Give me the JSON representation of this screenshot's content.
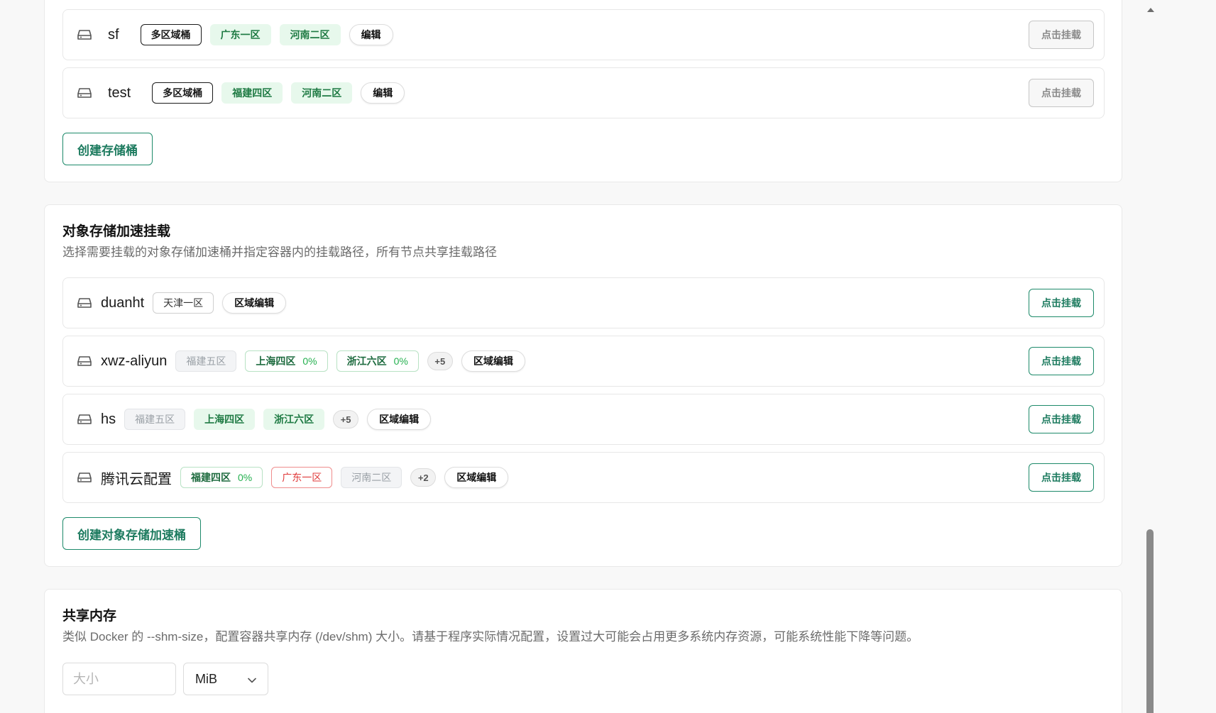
{
  "buckets_section": {
    "rows": [
      {
        "name": "sf",
        "tags": [
          {
            "label": "多区域桶",
            "style": "outline-dark"
          },
          {
            "label": "广东一区",
            "style": "green-fill"
          },
          {
            "label": "河南二区",
            "style": "green-fill"
          }
        ],
        "edit_label": "编辑",
        "mount_label": "点击挂载"
      },
      {
        "name": "test",
        "tags": [
          {
            "label": "多区域桶",
            "style": "outline-dark"
          },
          {
            "label": "福建四区",
            "style": "green-fill"
          },
          {
            "label": "河南二区",
            "style": "green-fill"
          }
        ],
        "edit_label": "编辑",
        "mount_label": "点击挂载"
      }
    ],
    "create_label": "创建存储桶"
  },
  "accel_section": {
    "title": "对象存储加速挂载",
    "description": "选择需要挂载的对象存储加速桶并指定容器内的挂载路径，所有节点共享挂载路径",
    "rows": [
      {
        "name": "duanht",
        "tags": [
          {
            "label": "天津一区",
            "pct": "",
            "style": "neutral-outline"
          }
        ],
        "count": "",
        "edit_label": "区域编辑",
        "mount_label": "点击挂载"
      },
      {
        "name": "xwz-aliyun",
        "tags": [
          {
            "label": "福建五区",
            "pct": "",
            "style": "gray"
          },
          {
            "label": "上海四区",
            "pct": "0%",
            "style": "green-outline"
          },
          {
            "label": "浙江六区",
            "pct": "0%",
            "style": "green-outline"
          }
        ],
        "count": "+5",
        "edit_label": "区域编辑",
        "mount_label": "点击挂载"
      },
      {
        "name": "hs",
        "tags": [
          {
            "label": "福建五区",
            "pct": "",
            "style": "gray"
          },
          {
            "label": "上海四区",
            "pct": "",
            "style": "green-fill"
          },
          {
            "label": "浙江六区",
            "pct": "",
            "style": "green-fill"
          }
        ],
        "count": "+5",
        "edit_label": "区域编辑",
        "mount_label": "点击挂载"
      },
      {
        "name": "腾讯云配置",
        "tags": [
          {
            "label": "福建四区",
            "pct": "0%",
            "style": "green-outline"
          },
          {
            "label": "广东一区",
            "pct": "",
            "style": "red-outline"
          },
          {
            "label": "河南二区",
            "pct": "",
            "style": "gray"
          }
        ],
        "count": "+2",
        "edit_label": "区域编辑",
        "mount_label": "点击挂载"
      }
    ],
    "create_label": "创建对象存储加速桶"
  },
  "shm_section": {
    "title": "共享内存",
    "description": "类似 Docker 的 --shm-size，配置容器共享内存 (/dev/shm) 大小。请基于程序实际情况配置，设置过大可能会占用更多系统内存资源，可能系统性能下降等问题。",
    "size_placeholder": "大小",
    "size_value": "",
    "unit": "MiB"
  },
  "icons": {
    "row": "hard-drive-icon",
    "select": "chevron-down-icon",
    "scroll": "scroll-up-arrow-icon"
  },
  "colors": {
    "accent": "#1d7b5f",
    "green_tag_bg": "#e7f8ec",
    "green_pct": "#24b04f",
    "red_tag": "#e03b3b"
  }
}
